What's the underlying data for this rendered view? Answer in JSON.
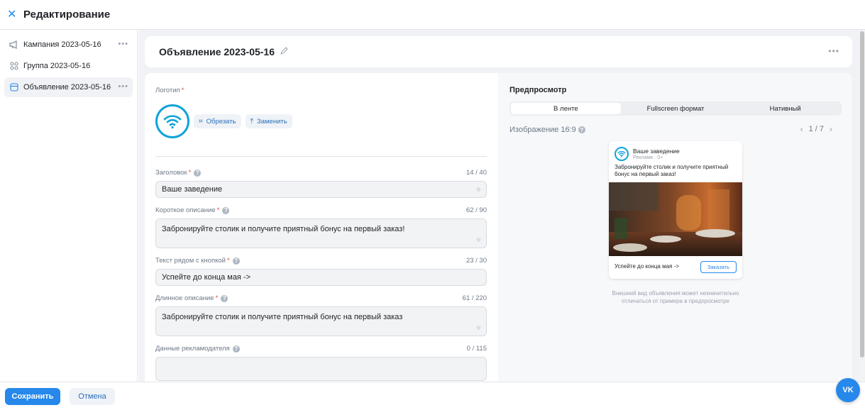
{
  "topbar": {
    "title": "Редактирование",
    "close_icon": "close-icon"
  },
  "sidebar": {
    "items": [
      {
        "label": "Кампания 2023-05-16",
        "icon": "megaphone-icon"
      },
      {
        "label": "Группа 2023-05-16",
        "icon": "grid-icon"
      },
      {
        "label": "Объявление 2023-05-16",
        "icon": "ad-icon",
        "active": true
      }
    ]
  },
  "header": {
    "title": "Объявление 2023-05-16"
  },
  "form": {
    "logo": {
      "label": "Логотип",
      "crop_label": "Обрезать",
      "replace_label": "Заменить"
    },
    "headline": {
      "label": "Заголовок",
      "counter": "14 / 40",
      "value": "Ваше заведение"
    },
    "short_desc": {
      "label": "Короткое описание",
      "counter": "62 / 90",
      "value": "Забронируйте столик и получите приятный бонус на первый заказ!"
    },
    "button_text": {
      "label": "Текст рядом с кнопкой",
      "counter": "23 / 30",
      "value": "Успейте до конца мая ->"
    },
    "long_desc": {
      "label": "Длинное описание",
      "counter": "61 / 220",
      "value": "Забронируйте столик и получите приятный бонус на первый заказ"
    },
    "advertiser": {
      "label": "Данные рекламодателя",
      "counter": "0 / 115",
      "value": ""
    }
  },
  "preview": {
    "title": "Предпросмотр",
    "tabs": [
      "В ленте",
      "Fullscreen формат",
      "Нативный"
    ],
    "active_tab": 0,
    "image_label": "Изображение 16:9",
    "pager": "1 / 7",
    "ad": {
      "name": "Ваше заведение",
      "sub": "Реклама · 0+",
      "text": "Забронируйте столик и получите приятный бонус на первый заказ!",
      "footer_text": "Успейте до конца мая ->",
      "button": "Заказать"
    },
    "note": "Внешний вид объявления может незначительно отличаться от примера в предпросмотре"
  },
  "footer": {
    "save": "Сохранить",
    "cancel": "Отмена"
  },
  "colors": {
    "accent": "#2688eb",
    "logo_ring": "#0fa3d9",
    "required": "#e64646"
  }
}
